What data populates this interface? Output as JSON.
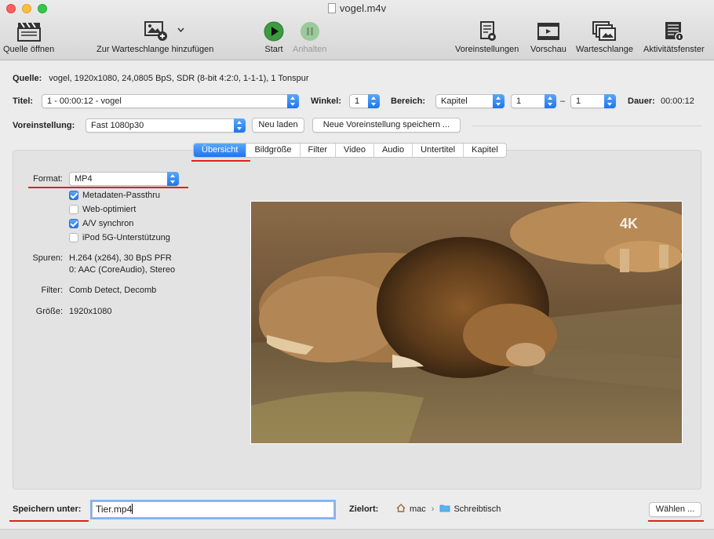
{
  "window": {
    "title": "vogel.m4v"
  },
  "toolbar": {
    "open_source": "Quelle öffnen",
    "add_to_queue": "Zur Warteschlange hinzufügen",
    "start": "Start",
    "pause": "Anhalten",
    "presets": "Voreinstellungen",
    "preview": "Vorschau",
    "queue": "Warteschlange",
    "activity": "Aktivitätsfenster"
  },
  "source": {
    "label": "Quelle:",
    "value": "vogel, 1920x1080, 24,0805 BpS, SDR (8-bit 4:2:0, 1-1-1), 1 Tonspur"
  },
  "title_row": {
    "title_label": "Titel:",
    "title_value": "1 - 00:00:12 - vogel",
    "angle_label": "Winkel:",
    "angle_value": "1",
    "range_label": "Bereich:",
    "range_type": "Kapitel",
    "range_from": "1",
    "range_dash": "–",
    "range_to": "1",
    "duration_label": "Dauer:",
    "duration_value": "00:00:12"
  },
  "preset_row": {
    "label": "Voreinstellung:",
    "value": "Fast 1080p30",
    "reload": "Neu laden",
    "save_new": "Neue Voreinstellung speichern ..."
  },
  "tabs": [
    "Übersicht",
    "Bildgröße",
    "Filter",
    "Video",
    "Audio",
    "Untertitel",
    "Kapitel"
  ],
  "summary": {
    "format_label": "Format:",
    "format_value": "MP4",
    "options": [
      {
        "label": "Metadaten-Passthru",
        "checked": true
      },
      {
        "label": "Web-optimiert",
        "checked": false
      },
      {
        "label": "A/V synchron",
        "checked": true
      },
      {
        "label": "iPod 5G-Unterstützung",
        "checked": false
      }
    ],
    "tracks_label": "Spuren:",
    "tracks_line1": "H.264 (x264), 30 BpS PFR",
    "tracks_line2": "0: AAC (CoreAudio), Stereo",
    "filters_label": "Filter:",
    "filters_value": "Comb Detect, Decomb",
    "size_label": "Größe:",
    "size_value": "1920x1080"
  },
  "preview_overlay": {
    "badge": "4K"
  },
  "save": {
    "label": "Speichern unter:",
    "filename": "Tier.mp4",
    "dest_label": "Zielort:",
    "dest_user": "mac",
    "dest_sep": "›",
    "dest_folder": "Schreibtisch",
    "choose": "Wählen ..."
  },
  "colors": {
    "accent": "#1f74ee",
    "highlight": "#e02020"
  }
}
